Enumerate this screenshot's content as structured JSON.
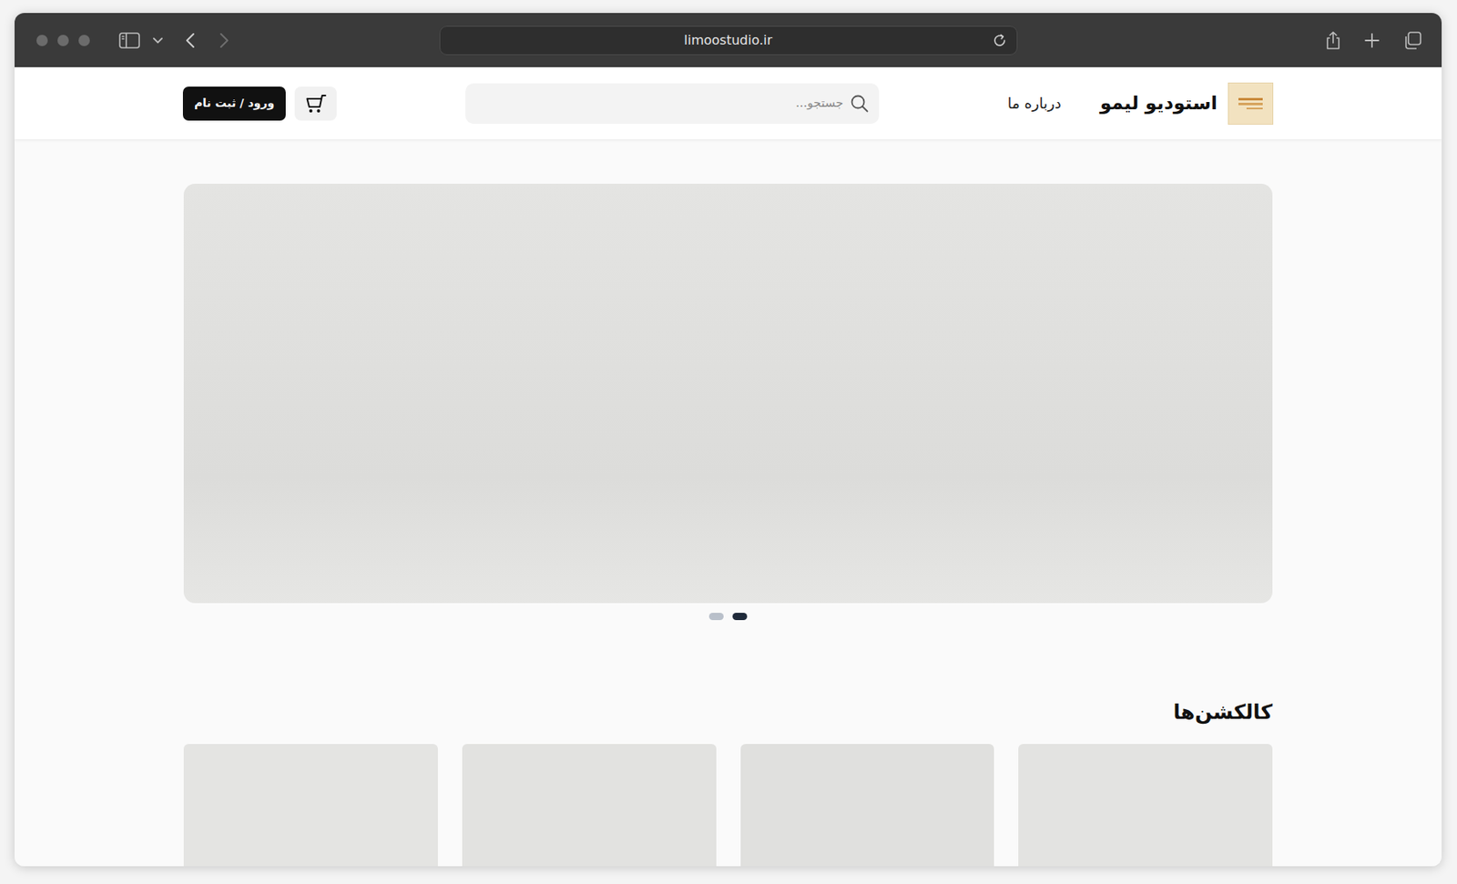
{
  "browser": {
    "url": "limoostudio.ir",
    "back_disabled": false,
    "forward_disabled": true
  },
  "header": {
    "brand": "استودیو لیمو",
    "nav": [
      {
        "label": "درباره ما"
      }
    ],
    "search": {
      "placeholder": "جستجو..."
    },
    "login": "ورود / ثبت نام"
  },
  "hero": {
    "slides": [
      {
        "selected": false
      },
      {
        "selected": true
      }
    ]
  },
  "collections": {
    "title": "کالکشن‌ها"
  }
}
